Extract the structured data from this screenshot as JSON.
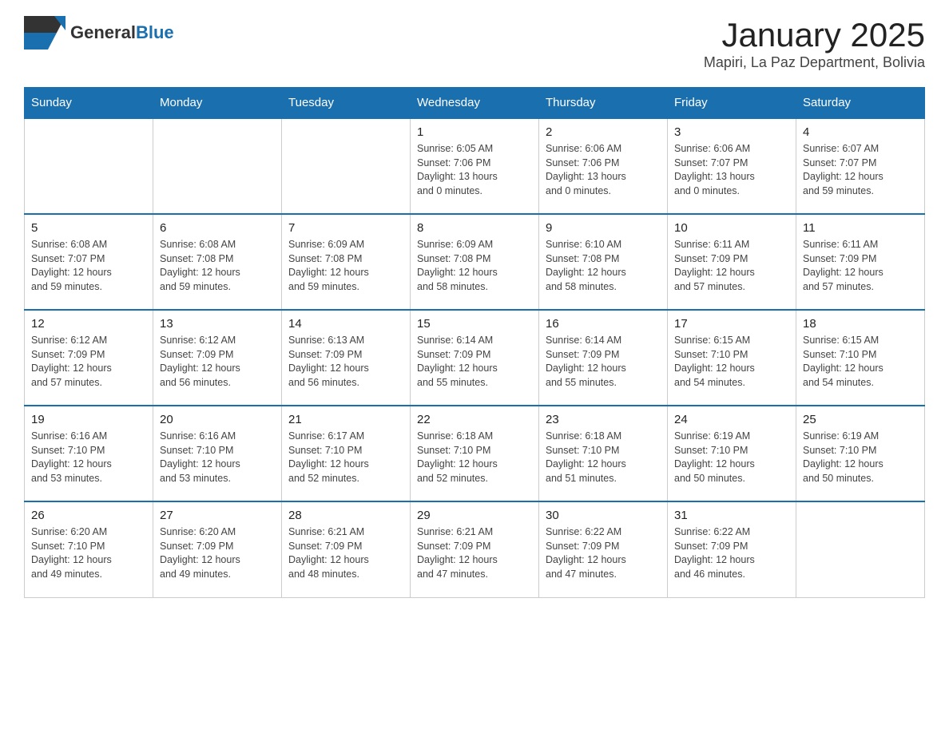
{
  "header": {
    "logo_general": "General",
    "logo_blue": "Blue",
    "title": "January 2025",
    "location": "Mapiri, La Paz Department, Bolivia"
  },
  "weekdays": [
    "Sunday",
    "Monday",
    "Tuesday",
    "Wednesday",
    "Thursday",
    "Friday",
    "Saturday"
  ],
  "weeks": [
    [
      {
        "day": "",
        "info": ""
      },
      {
        "day": "",
        "info": ""
      },
      {
        "day": "",
        "info": ""
      },
      {
        "day": "1",
        "info": "Sunrise: 6:05 AM\nSunset: 7:06 PM\nDaylight: 13 hours\nand 0 minutes."
      },
      {
        "day": "2",
        "info": "Sunrise: 6:06 AM\nSunset: 7:06 PM\nDaylight: 13 hours\nand 0 minutes."
      },
      {
        "day": "3",
        "info": "Sunrise: 6:06 AM\nSunset: 7:07 PM\nDaylight: 13 hours\nand 0 minutes."
      },
      {
        "day": "4",
        "info": "Sunrise: 6:07 AM\nSunset: 7:07 PM\nDaylight: 12 hours\nand 59 minutes."
      }
    ],
    [
      {
        "day": "5",
        "info": "Sunrise: 6:08 AM\nSunset: 7:07 PM\nDaylight: 12 hours\nand 59 minutes."
      },
      {
        "day": "6",
        "info": "Sunrise: 6:08 AM\nSunset: 7:08 PM\nDaylight: 12 hours\nand 59 minutes."
      },
      {
        "day": "7",
        "info": "Sunrise: 6:09 AM\nSunset: 7:08 PM\nDaylight: 12 hours\nand 59 minutes."
      },
      {
        "day": "8",
        "info": "Sunrise: 6:09 AM\nSunset: 7:08 PM\nDaylight: 12 hours\nand 58 minutes."
      },
      {
        "day": "9",
        "info": "Sunrise: 6:10 AM\nSunset: 7:08 PM\nDaylight: 12 hours\nand 58 minutes."
      },
      {
        "day": "10",
        "info": "Sunrise: 6:11 AM\nSunset: 7:09 PM\nDaylight: 12 hours\nand 57 minutes."
      },
      {
        "day": "11",
        "info": "Sunrise: 6:11 AM\nSunset: 7:09 PM\nDaylight: 12 hours\nand 57 minutes."
      }
    ],
    [
      {
        "day": "12",
        "info": "Sunrise: 6:12 AM\nSunset: 7:09 PM\nDaylight: 12 hours\nand 57 minutes."
      },
      {
        "day": "13",
        "info": "Sunrise: 6:12 AM\nSunset: 7:09 PM\nDaylight: 12 hours\nand 56 minutes."
      },
      {
        "day": "14",
        "info": "Sunrise: 6:13 AM\nSunset: 7:09 PM\nDaylight: 12 hours\nand 56 minutes."
      },
      {
        "day": "15",
        "info": "Sunrise: 6:14 AM\nSunset: 7:09 PM\nDaylight: 12 hours\nand 55 minutes."
      },
      {
        "day": "16",
        "info": "Sunrise: 6:14 AM\nSunset: 7:09 PM\nDaylight: 12 hours\nand 55 minutes."
      },
      {
        "day": "17",
        "info": "Sunrise: 6:15 AM\nSunset: 7:10 PM\nDaylight: 12 hours\nand 54 minutes."
      },
      {
        "day": "18",
        "info": "Sunrise: 6:15 AM\nSunset: 7:10 PM\nDaylight: 12 hours\nand 54 minutes."
      }
    ],
    [
      {
        "day": "19",
        "info": "Sunrise: 6:16 AM\nSunset: 7:10 PM\nDaylight: 12 hours\nand 53 minutes."
      },
      {
        "day": "20",
        "info": "Sunrise: 6:16 AM\nSunset: 7:10 PM\nDaylight: 12 hours\nand 53 minutes."
      },
      {
        "day": "21",
        "info": "Sunrise: 6:17 AM\nSunset: 7:10 PM\nDaylight: 12 hours\nand 52 minutes."
      },
      {
        "day": "22",
        "info": "Sunrise: 6:18 AM\nSunset: 7:10 PM\nDaylight: 12 hours\nand 52 minutes."
      },
      {
        "day": "23",
        "info": "Sunrise: 6:18 AM\nSunset: 7:10 PM\nDaylight: 12 hours\nand 51 minutes."
      },
      {
        "day": "24",
        "info": "Sunrise: 6:19 AM\nSunset: 7:10 PM\nDaylight: 12 hours\nand 50 minutes."
      },
      {
        "day": "25",
        "info": "Sunrise: 6:19 AM\nSunset: 7:10 PM\nDaylight: 12 hours\nand 50 minutes."
      }
    ],
    [
      {
        "day": "26",
        "info": "Sunrise: 6:20 AM\nSunset: 7:10 PM\nDaylight: 12 hours\nand 49 minutes."
      },
      {
        "day": "27",
        "info": "Sunrise: 6:20 AM\nSunset: 7:09 PM\nDaylight: 12 hours\nand 49 minutes."
      },
      {
        "day": "28",
        "info": "Sunrise: 6:21 AM\nSunset: 7:09 PM\nDaylight: 12 hours\nand 48 minutes."
      },
      {
        "day": "29",
        "info": "Sunrise: 6:21 AM\nSunset: 7:09 PM\nDaylight: 12 hours\nand 47 minutes."
      },
      {
        "day": "30",
        "info": "Sunrise: 6:22 AM\nSunset: 7:09 PM\nDaylight: 12 hours\nand 47 minutes."
      },
      {
        "day": "31",
        "info": "Sunrise: 6:22 AM\nSunset: 7:09 PM\nDaylight: 12 hours\nand 46 minutes."
      },
      {
        "day": "",
        "info": ""
      }
    ]
  ]
}
